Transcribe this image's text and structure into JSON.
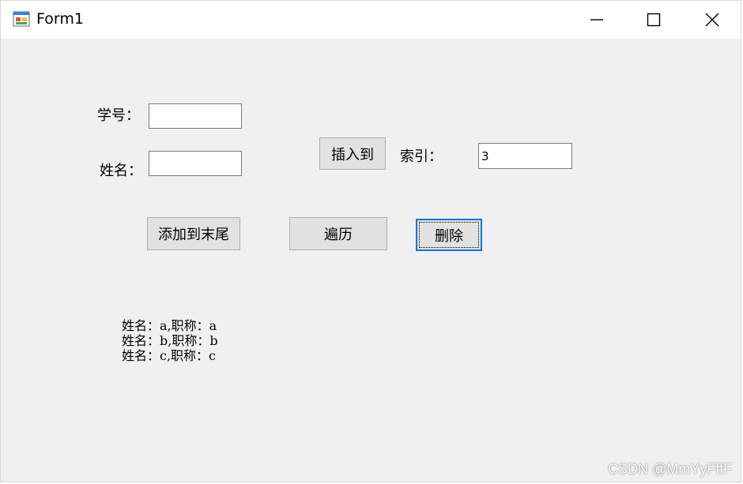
{
  "window": {
    "title": "Form1",
    "controls": {
      "minimize_icon": "minimize-icon",
      "maximize_icon": "maximize-icon",
      "close_icon": "close-icon"
    }
  },
  "form": {
    "student_id_label": "学号：",
    "student_id_value": "",
    "name_label": "姓名：",
    "name_value": "",
    "insert_button": "插入到",
    "index_label": "索引：",
    "index_value": "3",
    "append_button": "添加到末尾",
    "traverse_button": "遍历",
    "delete_button": "删除"
  },
  "output_lines": [
    "姓名：a,职称：a",
    "姓名：b,职称：b",
    "姓名：c,职称：c"
  ],
  "watermark": "CSDN @MmYyFffF",
  "colors": {
    "focus_border": "#0078d7",
    "button_face": "#e1e1e1",
    "form_background": "#f0f0f0"
  }
}
